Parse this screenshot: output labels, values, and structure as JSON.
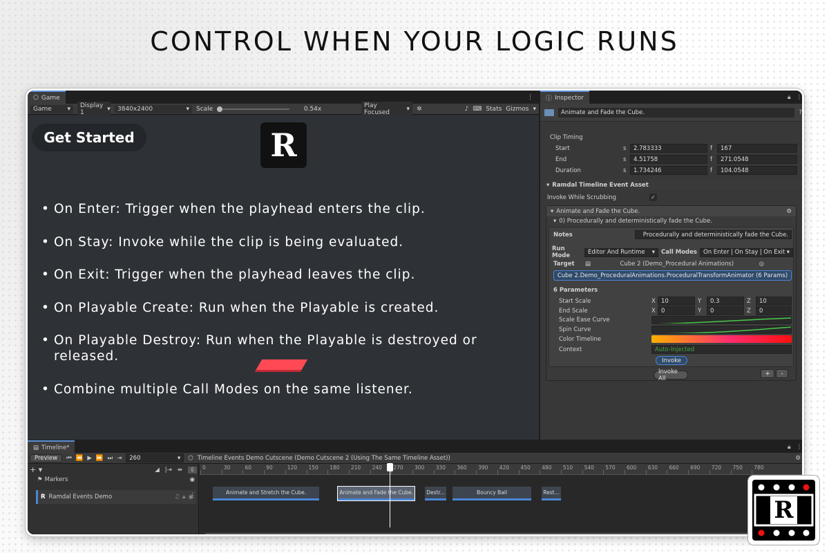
{
  "headline": "CONTROL WHEN YOUR LOGIC RUNS",
  "game": {
    "tab": "Game",
    "toolbar": {
      "mode": "Game",
      "display": "Display 1",
      "resolution": "3840x2400",
      "scale_label": "Scale",
      "scale_value": "0.54x",
      "play_mode": "Play Focused",
      "stats": "Stats",
      "gizmos": "Gizmos"
    },
    "get_started": "Get Started",
    "logo_letter": "R",
    "bullets": [
      "On Enter: Trigger when the playhead enters the clip.",
      "On Stay: Invoke while the clip is being evaluated.",
      "On Exit: Trigger when the playhead leaves the clip.",
      "On Playable Create: Run when the Playable is created.",
      "On Playable Destroy: Run when the Playable is destroyed or released.",
      "Combine multiple Call Modes on the same listener."
    ]
  },
  "inspector": {
    "tab": "Inspector",
    "object_name": "Animate and Fade the Cube.",
    "clip_timing": {
      "title": "Clip Timing",
      "start": {
        "label": "Start",
        "s": "2.783333",
        "f": "167"
      },
      "end": {
        "label": "End",
        "s": "4.51758",
        "f": "271.0548"
      },
      "duration": {
        "label": "Duration",
        "s": "1.734246",
        "f": "104.0548"
      },
      "s_unit": "s",
      "f_unit": "f"
    },
    "asset_title": "Ramdal Timeline Event Asset",
    "invoke_scrubbing": "Invoke While Scrubbing",
    "checkmark": "✓",
    "event_title": "Animate and Fade the Cube.",
    "listener_title": "0) Procedurally and deterministically fade the Cube.",
    "notes_label": "Notes",
    "notes_value": "Procedurally and deterministically fade the Cube.",
    "run_mode_label": "Run Mode",
    "run_mode_value": "Editor And Runtime",
    "call_modes_label": "Call Modes",
    "call_modes": [
      "On Enter",
      "On Stay",
      "On Exit"
    ],
    "target_label": "Target",
    "target_value": "Cube 2 (Demo_Procedural Animations)",
    "target_method": "Cube 2.Demo_ProceduralAnimations.ProceduralTransformAnimator (6 Params)",
    "params_title": "6 Parameters",
    "start_scale": {
      "label": "Start Scale",
      "x": "10",
      "y": "0.3",
      "z": "10"
    },
    "end_scale": {
      "label": "End Scale",
      "x": "0",
      "y": "0",
      "z": "0"
    },
    "axis": {
      "x": "X",
      "y": "Y",
      "z": "Z"
    },
    "scale_ease": "Scale Ease Curve",
    "spin_curve": "Spin Curve",
    "color_timeline": "Color Timeline",
    "context_label": "Context",
    "context_value": "Auto-Injected",
    "invoke": "Invoke",
    "invoke_all": "Invoke All",
    "plus": "+",
    "minus": "-"
  },
  "timeline": {
    "tab": "Timeline*",
    "preview": "Preview",
    "frame": "260",
    "asset_path": "Timeline Events Demo Cutscene (Demo Cutscene 2 (Using The Same Timeline Asset))",
    "markers": "Markers",
    "track_name": "Ramdal Events Demo",
    "ticks": [
      "0",
      "30",
      "60",
      "90",
      "120",
      "150",
      "180",
      "210",
      "240",
      "270",
      "300",
      "330",
      "360",
      "390",
      "420",
      "450",
      "480",
      "510",
      "540",
      "570",
      "600",
      "630",
      "660",
      "690",
      "720",
      "750",
      "780"
    ],
    "clips": [
      {
        "label": "Animate and Stretch the Cube.",
        "start": 0.5,
        "end": 5.5
      },
      {
        "label": "Animate and Fade the Cube.",
        "start": 6.4,
        "end": 10.0
      },
      {
        "label": "Destr...",
        "start": 10.5,
        "end": 11.5
      },
      {
        "label": "Bouncy Ball",
        "start": 11.8,
        "end": 15.5
      },
      {
        "label": "Rest...",
        "start": 16.0,
        "end": 16.9
      }
    ],
    "playhead_frame": 268
  },
  "corner_logo_letter": "R",
  "colors": {
    "accent": "#4b87d6",
    "cube": "#ff4a55",
    "curve": "#49c94a"
  }
}
